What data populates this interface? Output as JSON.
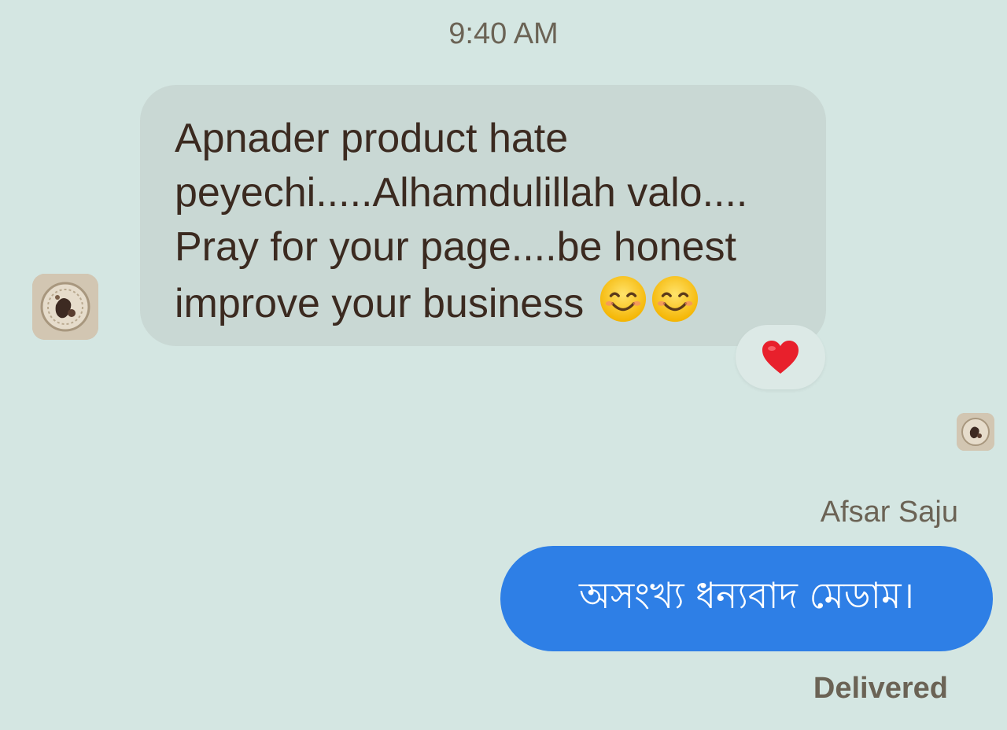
{
  "timestamp": "9:40 AM",
  "incoming_message": {
    "lines": [
      "Apnader product hate",
      "peyechi.....Alhamdulillah valo....",
      "Pray for your page....be honest",
      "improve your business"
    ],
    "emoji": [
      "smiling-face-with-smiling-eyes",
      "smiling-face-with-smiling-eyes"
    ],
    "reaction": "red-heart",
    "bubble_color": "#c9d8d4"
  },
  "outgoing_message": {
    "sender_name": "Afsar Saju",
    "text": "অসংখ্য ধন্যবাদ মেডাম।",
    "status": "Delivered",
    "bubble_color": "#2e7fe6"
  },
  "colors": {
    "background": "#d4e6e2",
    "meta_text": "#6b6355",
    "heart": "#e8202c"
  }
}
